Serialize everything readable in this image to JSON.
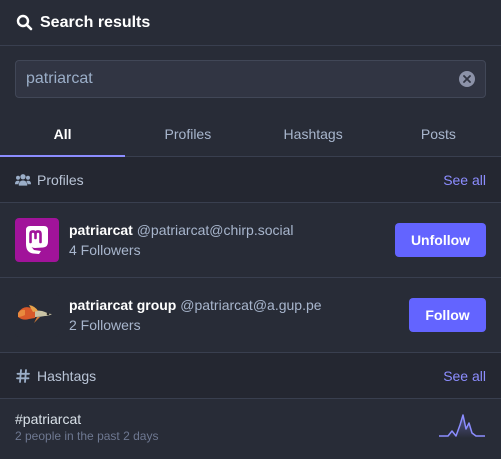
{
  "header": {
    "title": "Search results",
    "icon": "search-icon"
  },
  "search": {
    "value": "patriarcat",
    "placeholder": "Search"
  },
  "tabs": [
    {
      "label": "All",
      "active": true
    },
    {
      "label": "Profiles",
      "active": false
    },
    {
      "label": "Hashtags",
      "active": false
    },
    {
      "label": "Posts",
      "active": false
    }
  ],
  "profiles_section": {
    "title": "Profiles",
    "see_all": "See all",
    "icon": "users-icon"
  },
  "accounts": [
    {
      "name": "patriarcat",
      "handle": "@patriarcat@chirp.social",
      "followers": "4 Followers",
      "button": "Unfollow",
      "avatar": "mastodon-logo"
    },
    {
      "name": "patriarcat group",
      "handle": "@patriarcat@a.gup.pe",
      "followers": "2 Followers",
      "button": "Follow",
      "avatar": "guppy-fish"
    }
  ],
  "hashtags_section": {
    "title": "Hashtags",
    "see_all": "See all",
    "icon": "hash-icon"
  },
  "hashtags": [
    {
      "name": "#patriarcat",
      "meta": "2 people in the past 2 days"
    }
  ],
  "colors": {
    "accent": "#6364ff",
    "link": "#8c8dff",
    "background": "#282c37"
  }
}
